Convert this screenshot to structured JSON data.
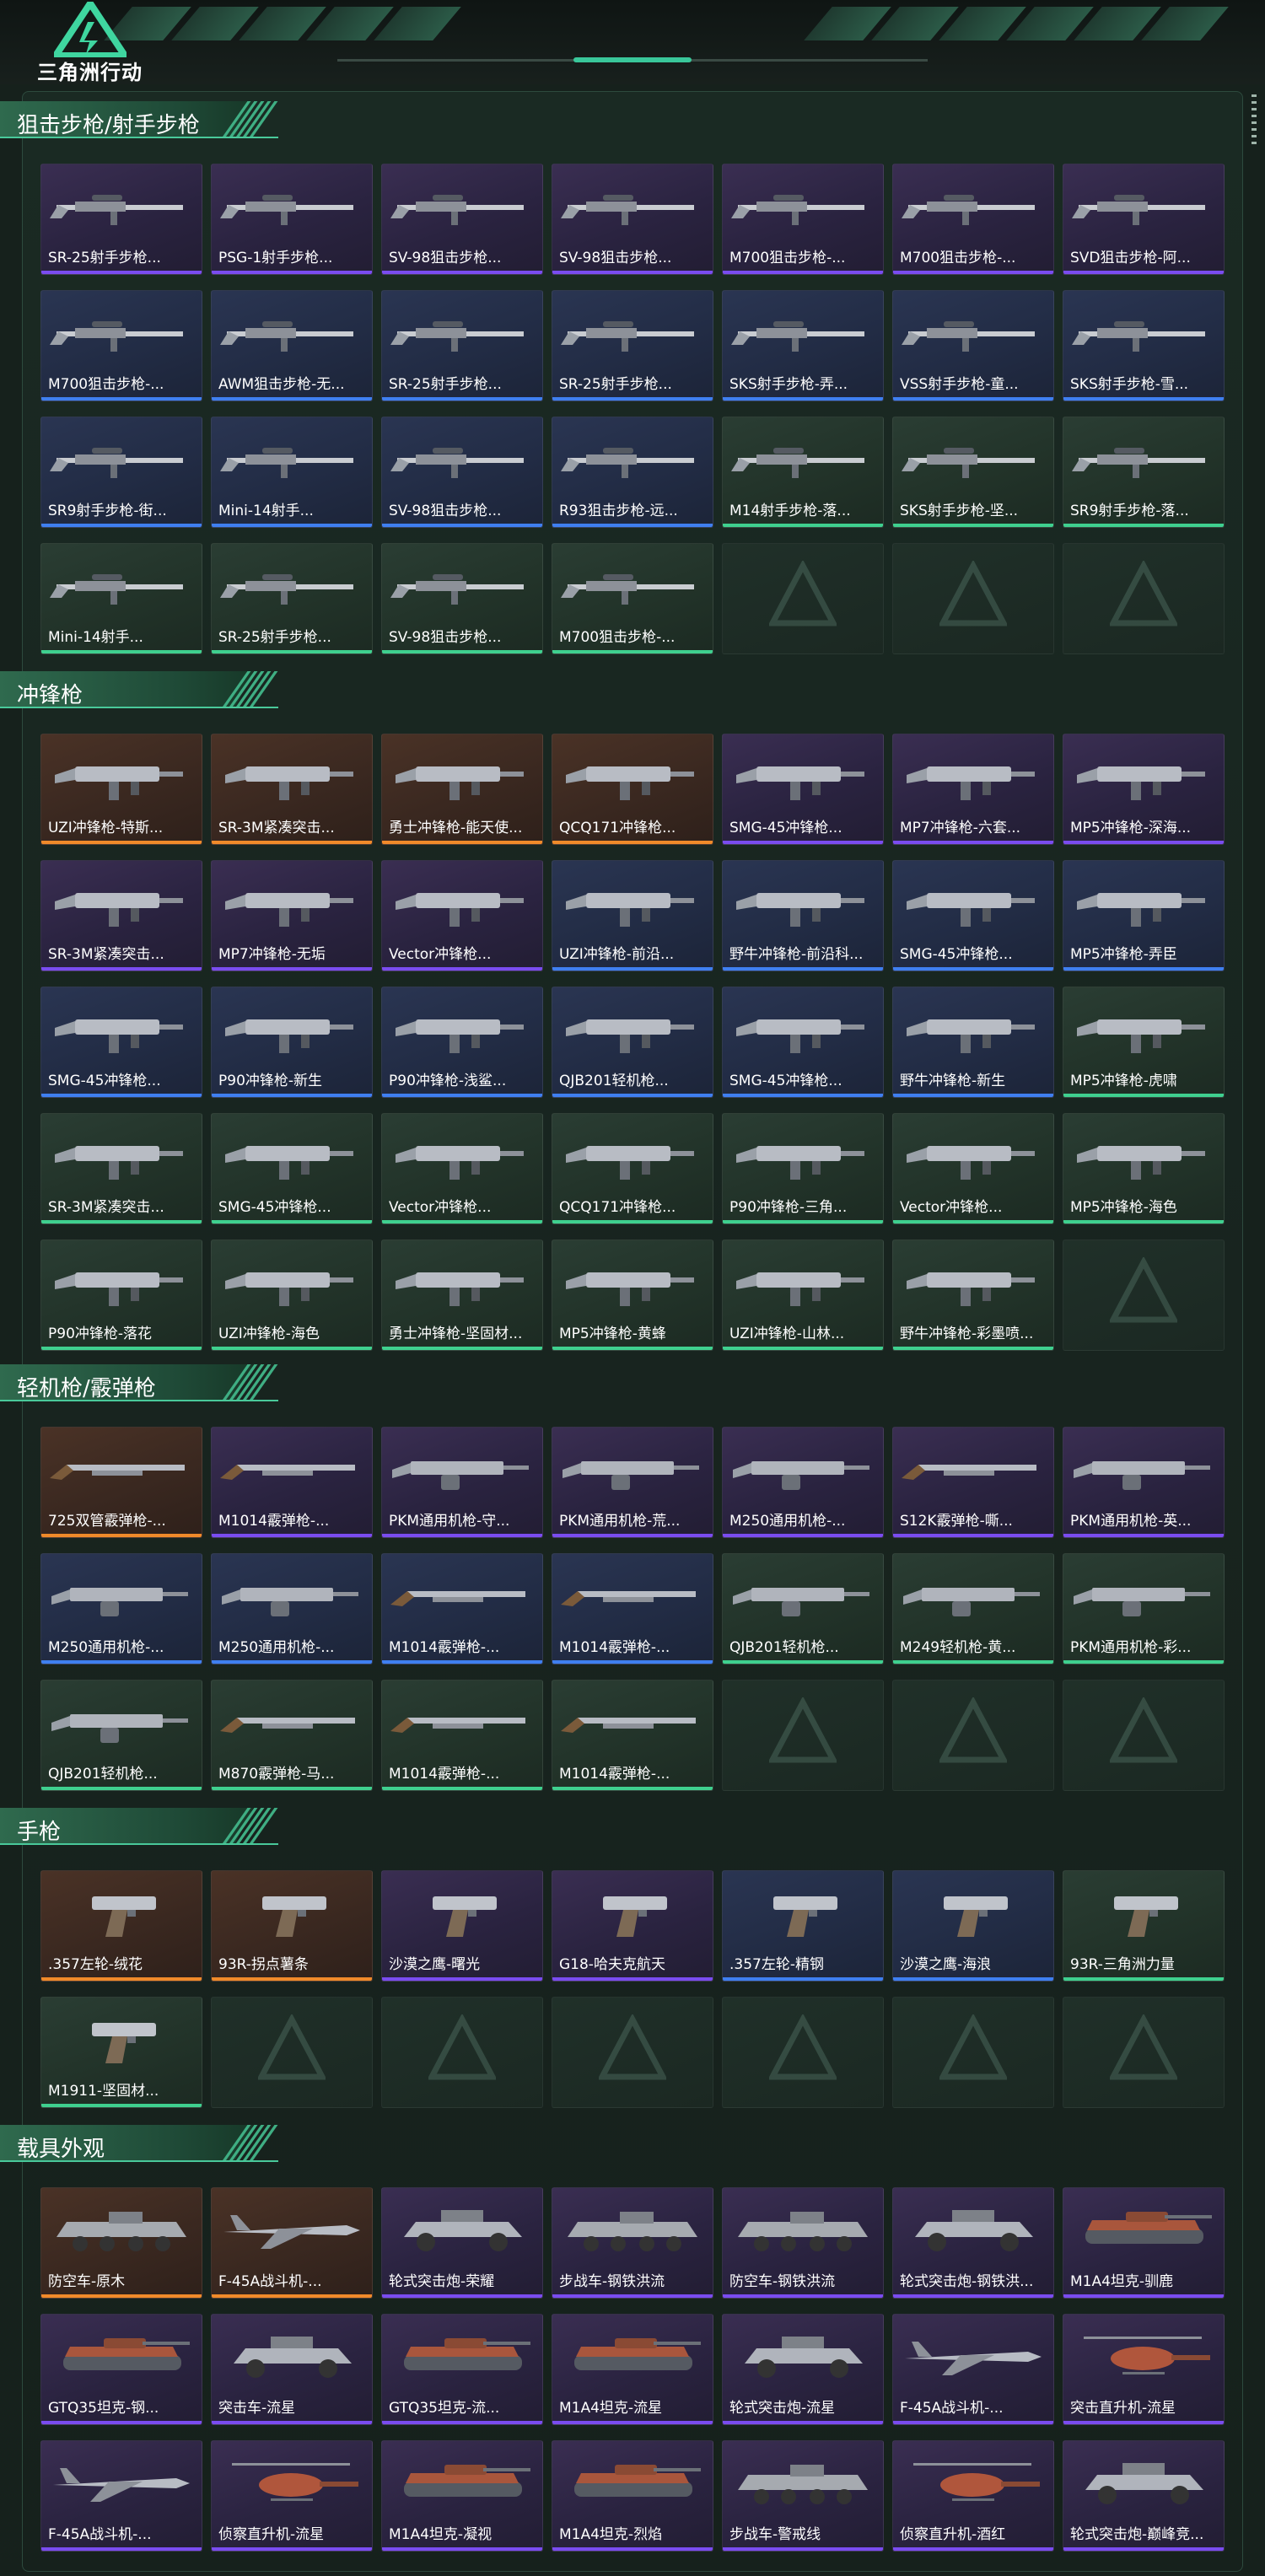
{
  "app": {
    "title": "三角洲行动"
  },
  "colors": {
    "rarity_purple": "#7a4cf0",
    "rarity_blue": "#3f7ff0",
    "rarity_green": "#3fd08f",
    "rarity_orange": "#f08a2a",
    "rarity_gold": "#f0c040",
    "accent": "#49c99a"
  },
  "sections": [
    {
      "title": "狙击步枪/射手步枪",
      "items": [
        {
          "label": "SR-25射手步枪...",
          "rarity": "purple",
          "icon": "rifle-icon"
        },
        {
          "label": "PSG-1射手步枪...",
          "rarity": "purple",
          "icon": "rifle-icon"
        },
        {
          "label": "SV-98狙击步枪...",
          "rarity": "purple",
          "icon": "rifle-icon"
        },
        {
          "label": "SV-98狙击步枪...",
          "rarity": "purple",
          "icon": "rifle-icon"
        },
        {
          "label": "M700狙击步枪-...",
          "rarity": "purple",
          "icon": "rifle-icon"
        },
        {
          "label": "M700狙击步枪-...",
          "rarity": "purple",
          "icon": "rifle-icon"
        },
        {
          "label": "SVD狙击步枪-阿...",
          "rarity": "purple",
          "icon": "rifle-icon"
        },
        {
          "label": "M700狙击步枪-...",
          "rarity": "blue",
          "icon": "rifle-icon"
        },
        {
          "label": "AWM狙击步枪-无...",
          "rarity": "blue",
          "icon": "rifle-icon"
        },
        {
          "label": "SR-25射手步枪...",
          "rarity": "blue",
          "icon": "rifle-icon"
        },
        {
          "label": "SR-25射手步枪...",
          "rarity": "blue",
          "icon": "rifle-icon"
        },
        {
          "label": "SKS射手步枪-弄...",
          "rarity": "blue",
          "icon": "rifle-icon"
        },
        {
          "label": "VSS射手步枪-童...",
          "rarity": "blue",
          "icon": "rifle-icon"
        },
        {
          "label": "SKS射手步枪-雪...",
          "rarity": "blue",
          "icon": "rifle-icon"
        },
        {
          "label": "SR9射手步枪-街...",
          "rarity": "blue",
          "icon": "rifle-icon"
        },
        {
          "label": "Mini-14射手...",
          "rarity": "blue",
          "icon": "rifle-icon"
        },
        {
          "label": "SV-98狙击步枪...",
          "rarity": "blue",
          "icon": "rifle-icon"
        },
        {
          "label": "R93狙击步枪-远...",
          "rarity": "blue",
          "icon": "rifle-icon"
        },
        {
          "label": "M14射手步枪-落...",
          "rarity": "green",
          "icon": "rifle-icon"
        },
        {
          "label": "SKS射手步枪-坚...",
          "rarity": "green",
          "icon": "rifle-icon"
        },
        {
          "label": "SR9射手步枪-落...",
          "rarity": "green",
          "icon": "rifle-icon"
        },
        {
          "label": "Mini-14射手...",
          "rarity": "green",
          "icon": "rifle-icon"
        },
        {
          "label": "SR-25射手步枪...",
          "rarity": "green",
          "icon": "rifle-icon"
        },
        {
          "label": "SV-98狙击步枪...",
          "rarity": "green",
          "icon": "rifle-icon"
        },
        {
          "label": "M700狙击步枪-...",
          "rarity": "green",
          "icon": "rifle-icon"
        }
      ],
      "empty_slots": 3
    },
    {
      "title": "冲锋枪",
      "items": [
        {
          "label": "UZI冲锋枪-特斯...",
          "rarity": "orange",
          "icon": "smg-icon"
        },
        {
          "label": "SR-3M紧凑突击...",
          "rarity": "orange",
          "icon": "smg-icon"
        },
        {
          "label": "勇士冲锋枪-能天使...",
          "rarity": "orange",
          "icon": "smg-icon"
        },
        {
          "label": "QCQ171冲锋枪...",
          "rarity": "orange",
          "icon": "smg-icon"
        },
        {
          "label": "SMG-45冲锋枪...",
          "rarity": "purple",
          "icon": "smg-icon"
        },
        {
          "label": "MP7冲锋枪-六套...",
          "rarity": "purple",
          "icon": "smg-icon"
        },
        {
          "label": "MP5冲锋枪-深海...",
          "rarity": "purple",
          "icon": "smg-icon"
        },
        {
          "label": "SR-3M紧凑突击...",
          "rarity": "purple",
          "icon": "smg-icon"
        },
        {
          "label": "MP7冲锋枪-无垢",
          "rarity": "purple",
          "icon": "smg-icon"
        },
        {
          "label": "Vector冲锋枪...",
          "rarity": "purple",
          "icon": "smg-icon"
        },
        {
          "label": "UZI冲锋枪-前沿...",
          "rarity": "blue",
          "icon": "smg-icon"
        },
        {
          "label": "野牛冲锋枪-前沿科...",
          "rarity": "blue",
          "icon": "smg-icon"
        },
        {
          "label": "SMG-45冲锋枪...",
          "rarity": "blue",
          "icon": "smg-icon"
        },
        {
          "label": "MP5冲锋枪-弄臣",
          "rarity": "blue",
          "icon": "smg-icon"
        },
        {
          "label": "SMG-45冲锋枪...",
          "rarity": "blue",
          "icon": "smg-icon"
        },
        {
          "label": "P90冲锋枪-新生",
          "rarity": "blue",
          "icon": "smg-icon"
        },
        {
          "label": "P90冲锋枪-浅鲨...",
          "rarity": "blue",
          "icon": "smg-icon"
        },
        {
          "label": "QJB201轻机枪...",
          "rarity": "blue",
          "icon": "smg-icon"
        },
        {
          "label": "SMG-45冲锋枪...",
          "rarity": "blue",
          "icon": "smg-icon"
        },
        {
          "label": "野牛冲锋枪-新生",
          "rarity": "blue",
          "icon": "smg-icon"
        },
        {
          "label": "MP5冲锋枪-虎啸",
          "rarity": "green",
          "icon": "smg-icon"
        },
        {
          "label": "SR-3M紧凑突击...",
          "rarity": "green",
          "icon": "smg-icon"
        },
        {
          "label": "SMG-45冲锋枪...",
          "rarity": "green",
          "icon": "smg-icon"
        },
        {
          "label": "Vector冲锋枪...",
          "rarity": "green",
          "icon": "smg-icon"
        },
        {
          "label": "QCQ171冲锋枪...",
          "rarity": "green",
          "icon": "smg-icon"
        },
        {
          "label": "P90冲锋枪-三角...",
          "rarity": "green",
          "icon": "smg-icon"
        },
        {
          "label": "Vector冲锋枪...",
          "rarity": "green",
          "icon": "smg-icon"
        },
        {
          "label": "MP5冲锋枪-海色",
          "rarity": "green",
          "icon": "smg-icon"
        },
        {
          "label": "P90冲锋枪-落花",
          "rarity": "green",
          "icon": "smg-icon"
        },
        {
          "label": "UZI冲锋枪-海色",
          "rarity": "green",
          "icon": "smg-icon"
        },
        {
          "label": "勇士冲锋枪-坚固材...",
          "rarity": "green",
          "icon": "smg-icon"
        },
        {
          "label": "MP5冲锋枪-黄蜂",
          "rarity": "green",
          "icon": "smg-icon"
        },
        {
          "label": "UZI冲锋枪-山林...",
          "rarity": "green",
          "icon": "smg-icon"
        },
        {
          "label": "野牛冲锋枪-彩墨喷...",
          "rarity": "green",
          "icon": "smg-icon"
        }
      ],
      "empty_slots": 1
    },
    {
      "title": "轻机枪/霰弹枪",
      "items": [
        {
          "label": "725双管霰弹枪-...",
          "rarity": "orange",
          "icon": "shotgun-icon"
        },
        {
          "label": "M1014霰弹枪-...",
          "rarity": "purple",
          "icon": "shotgun-icon"
        },
        {
          "label": "PKM通用机枪-守...",
          "rarity": "purple",
          "icon": "lmg-icon"
        },
        {
          "label": "PKM通用机枪-荒...",
          "rarity": "purple",
          "icon": "lmg-icon"
        },
        {
          "label": "M250通用机枪-...",
          "rarity": "purple",
          "icon": "lmg-icon"
        },
        {
          "label": "S12K霰弹枪-嘶...",
          "rarity": "purple",
          "icon": "shotgun-icon"
        },
        {
          "label": "PKM通用机枪-英...",
          "rarity": "purple",
          "icon": "lmg-icon"
        },
        {
          "label": "M250通用机枪-...",
          "rarity": "blue",
          "icon": "lmg-icon"
        },
        {
          "label": "M250通用机枪-...",
          "rarity": "blue",
          "icon": "lmg-icon"
        },
        {
          "label": "M1014霰弹枪-...",
          "rarity": "blue",
          "icon": "shotgun-icon"
        },
        {
          "label": "M1014霰弹枪-...",
          "rarity": "blue",
          "icon": "shotgun-icon"
        },
        {
          "label": "QJB201轻机枪...",
          "rarity": "green",
          "icon": "lmg-icon"
        },
        {
          "label": "M249轻机枪-黄...",
          "rarity": "green",
          "icon": "lmg-icon"
        },
        {
          "label": "PKM通用机枪-彩...",
          "rarity": "green",
          "icon": "lmg-icon"
        },
        {
          "label": "QJB201轻机枪...",
          "rarity": "green",
          "icon": "lmg-icon"
        },
        {
          "label": "M870霰弹枪-马...",
          "rarity": "green",
          "icon": "shotgun-icon"
        },
        {
          "label": "M1014霰弹枪-...",
          "rarity": "green",
          "icon": "shotgun-icon"
        },
        {
          "label": "M1014霰弹枪-...",
          "rarity": "green",
          "icon": "shotgun-icon"
        }
      ],
      "empty_slots": 3
    },
    {
      "title": "手枪",
      "items": [
        {
          "label": ".357左轮-绒花",
          "rarity": "orange",
          "icon": "pistol-icon"
        },
        {
          "label": "93R-拐点薯条",
          "rarity": "orange",
          "icon": "pistol-icon"
        },
        {
          "label": "沙漠之鹰-曙光",
          "rarity": "purple",
          "icon": "pistol-icon"
        },
        {
          "label": "G18-哈夫克航天",
          "rarity": "purple",
          "icon": "pistol-icon"
        },
        {
          "label": ".357左轮-精钢",
          "rarity": "blue",
          "icon": "pistol-icon"
        },
        {
          "label": "沙漠之鹰-海浪",
          "rarity": "blue",
          "icon": "pistol-icon"
        },
        {
          "label": "93R-三角洲力量",
          "rarity": "green",
          "icon": "pistol-icon"
        },
        {
          "label": "M1911-坚固材...",
          "rarity": "green",
          "icon": "pistol-icon"
        }
      ],
      "empty_slots": 6
    },
    {
      "title": "载具外观",
      "items": [
        {
          "label": "防空车-原木",
          "rarity": "orange",
          "icon": "apc-icon"
        },
        {
          "label": "F-45A战斗机-...",
          "rarity": "orange",
          "icon": "jet-icon"
        },
        {
          "label": "轮式突击炮-荣耀",
          "rarity": "purple",
          "icon": "buggy-icon"
        },
        {
          "label": "步战车-钢铁洪流",
          "rarity": "purple",
          "icon": "apc-icon"
        },
        {
          "label": "防空车-钢铁洪流",
          "rarity": "purple",
          "icon": "apc-icon"
        },
        {
          "label": "轮式突击炮-钢铁洪...",
          "rarity": "purple",
          "icon": "buggy-icon"
        },
        {
          "label": "M1A4坦克-驯鹿",
          "rarity": "purple",
          "icon": "tank-icon"
        },
        {
          "label": "GTQ35坦克-钢...",
          "rarity": "purple",
          "icon": "tank-icon"
        },
        {
          "label": "突击车-流星",
          "rarity": "purple",
          "icon": "buggy-icon"
        },
        {
          "label": "GTQ35坦克-流...",
          "rarity": "purple",
          "icon": "tank-icon"
        },
        {
          "label": "M1A4坦克-流星",
          "rarity": "purple",
          "icon": "tank-icon"
        },
        {
          "label": "轮式突击炮-流星",
          "rarity": "purple",
          "icon": "buggy-icon"
        },
        {
          "label": "F-45A战斗机-...",
          "rarity": "purple",
          "icon": "jet-icon"
        },
        {
          "label": "突击直升机-流星",
          "rarity": "purple",
          "icon": "helicopter-icon"
        },
        {
          "label": "F-45A战斗机-...",
          "rarity": "purple",
          "icon": "jet-icon"
        },
        {
          "label": "侦察直升机-流星",
          "rarity": "purple",
          "icon": "helicopter-icon"
        },
        {
          "label": "M1A4坦克-凝视",
          "rarity": "purple",
          "icon": "tank-icon"
        },
        {
          "label": "M1A4坦克-烈焰",
          "rarity": "purple",
          "icon": "tank-icon"
        },
        {
          "label": "步战车-警戒线",
          "rarity": "purple",
          "icon": "apc-icon"
        },
        {
          "label": "侦察直升机-酒红",
          "rarity": "purple",
          "icon": "helicopter-icon"
        },
        {
          "label": "轮式突击炮-巅峰竞...",
          "rarity": "purple",
          "icon": "buggy-icon"
        }
      ],
      "empty_slots": 0
    }
  ]
}
